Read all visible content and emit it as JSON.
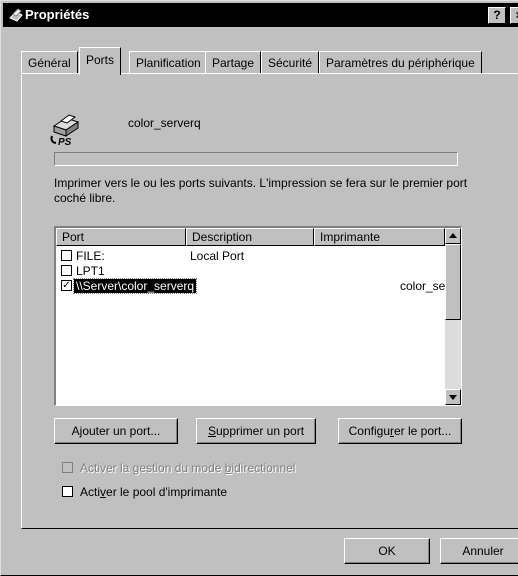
{
  "window": {
    "title": "Propriétés",
    "help_label": "?",
    "close_label": "×"
  },
  "tabs": [
    {
      "label": "Général"
    },
    {
      "label": "Ports"
    },
    {
      "label": "Planification"
    },
    {
      "label": "Partage"
    },
    {
      "label": "Sécurité"
    },
    {
      "label": "Paramètres du périphérique"
    }
  ],
  "active_tab": "Ports",
  "printer": {
    "name": "color_serverq",
    "icon": "printer-ps-icon"
  },
  "description": "Imprimer vers le ou les ports suivants. L'impression se fera sur le premier port coché libre.",
  "ports_table": {
    "columns": [
      "Port",
      "Description",
      "Imprimante"
    ],
    "rows": [
      {
        "checked": false,
        "port": "FILE:",
        "description": "Local Port",
        "printer": ""
      },
      {
        "checked": false,
        "port": "LPT1",
        "description": "",
        "printer": ""
      },
      {
        "checked": true,
        "selected": true,
        "port": "\\\\Server\\color_serverq",
        "description": "",
        "printer": "color_se"
      }
    ]
  },
  "buttons": {
    "add_port": {
      "pre": "A",
      "u": "j",
      "post": "outer un port..."
    },
    "delete_port": {
      "pre": "",
      "u": "S",
      "post": "upprimer un port"
    },
    "configure_port": {
      "pre": "Configu",
      "u": "r",
      "post": "er le port..."
    }
  },
  "options": {
    "bidirectional": {
      "pre": "Activer la gestion du mode ",
      "u": "b",
      "post": "idirectionnel",
      "checked": false,
      "enabled": false
    },
    "pool": {
      "pre": "Acti",
      "u": "v",
      "post": "er le pool d'imprimante",
      "checked": false,
      "enabled": true
    }
  },
  "footer": {
    "ok_label": "OK",
    "cancel_label": "Annuler"
  }
}
